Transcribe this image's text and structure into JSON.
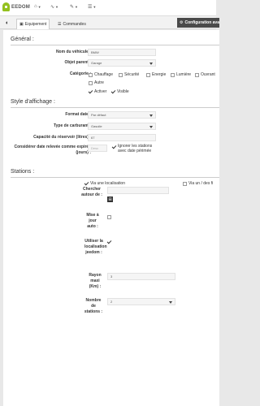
{
  "navbar": {
    "logo": "EEDOM",
    "menus": [
      {
        "icon": "home-icon",
        "glyph": "⌂"
      },
      {
        "icon": "analysis-icon",
        "glyph": "∿"
      },
      {
        "icon": "tools-icon",
        "glyph": "✎"
      },
      {
        "icon": "list-icon",
        "glyph": "☰"
      }
    ]
  },
  "tabs": {
    "back_glyph": "◐",
    "equipment": "Equipement",
    "commands": "Commandes",
    "config_button": "Configuration ava"
  },
  "general": {
    "title": "Général :",
    "vehicle_name_label": "Nom du véhicule :",
    "vehicle_name_value": "BMW",
    "parent_label": "Objet parent :",
    "parent_value": "Garage",
    "category_label": "Catégorie :",
    "categories": [
      {
        "label": "Chauffage",
        "checked": false
      },
      {
        "label": "Sécurité",
        "checked": false
      },
      {
        "label": "Energie",
        "checked": false
      },
      {
        "label": "Lumière",
        "checked": false
      },
      {
        "label": "Ouvrant",
        "checked": false
      },
      {
        "label": "Autre",
        "checked": false
      }
    ],
    "activate_label": "Activer",
    "visible_label": "Visible"
  },
  "display": {
    "title": "Style d'affichage :",
    "date_format_label": "Format date :",
    "date_format_value": "Par défaut",
    "fuel_type_label": "Type de carburant :",
    "fuel_type_value": "Gasoile",
    "tank_label": "Capacité du réservoir (litres) :",
    "tank_value": "67",
    "expired_label": "Considérer date relevée comme expirée (jours) :",
    "expired_placeholder": "Desc",
    "ignore_expired_label": "Ignorer les stations avec date périmée"
  },
  "stations": {
    "title": "Stations :",
    "via_location_label": "Via une localisation",
    "via_other_label": "Via un / des fi",
    "search_label": "Chercher autour de :",
    "update_label": "Mise à jour auto :",
    "use_location_label": "Utiliser la localisation jeedom :",
    "radius_label": "Rayon maxi (Km) :",
    "radius_value": "3",
    "count_label": "Nombre de stations :",
    "count_value": "2"
  }
}
